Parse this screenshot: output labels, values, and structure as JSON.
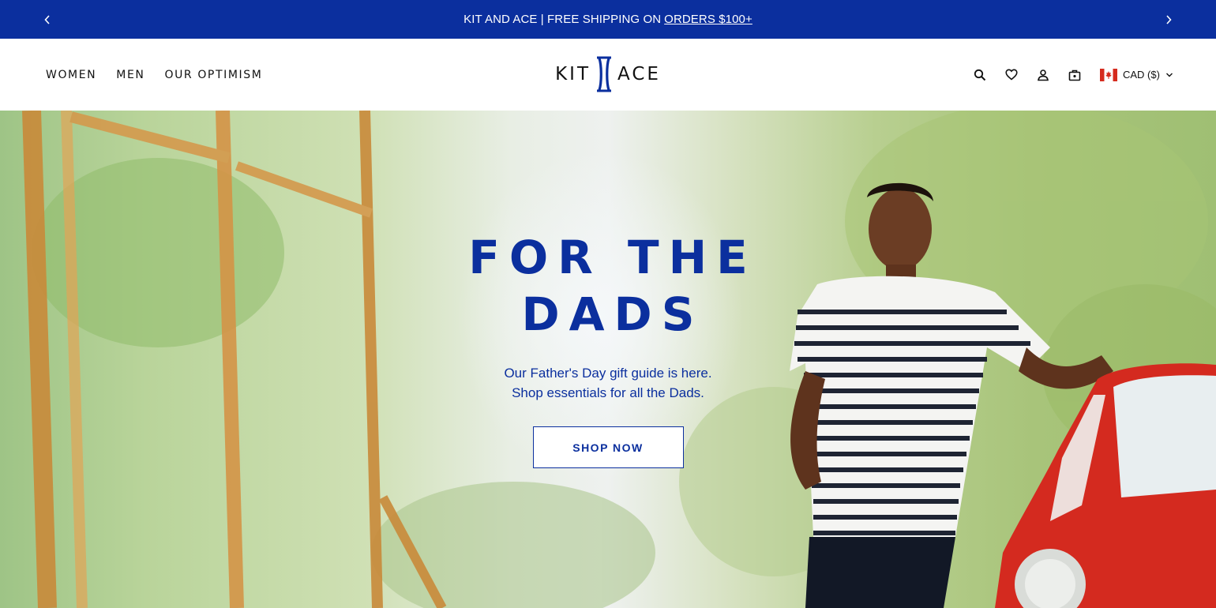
{
  "announcement": {
    "prev_icon": "chevron-left-icon",
    "next_icon": "chevron-right-icon",
    "text": "KIT AND ACE | FREE SHIPPING ON",
    "link": "ORDERS $100+"
  },
  "header": {
    "nav": [
      {
        "label": "WOMEN"
      },
      {
        "label": "MEN"
      },
      {
        "label": "OUR OPTIMISM"
      }
    ],
    "logo": {
      "left": "KIT",
      "right": "ACE"
    },
    "icons": [
      "search-icon",
      "heart-icon",
      "account-icon",
      "bag-icon"
    ],
    "currency": {
      "label": "CAD ($)",
      "flag": "canada-flag-icon"
    }
  },
  "hero": {
    "title": "FOR THE\nDADS",
    "subtitle_line1": "Our Father's Day gift guide is here.",
    "subtitle_line2": "Shop essentials for all the Dads.",
    "cta": "SHOP NOW"
  },
  "colors": {
    "brand_blue": "#0b2f9e",
    "white": "#ffffff",
    "canada_red": "#d52b1e"
  }
}
